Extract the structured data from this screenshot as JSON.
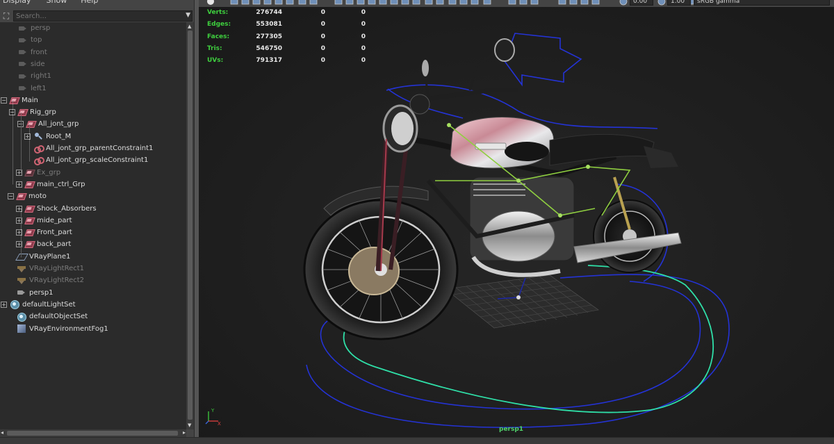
{
  "menu": {
    "display": "Display",
    "show": "Show",
    "help": "Help"
  },
  "search": {
    "placeholder": "Search..."
  },
  "outliner": {
    "items": [
      {
        "label": "persp",
        "icon": "camera-icon",
        "dim": true
      },
      {
        "label": "top",
        "icon": "camera-icon",
        "dim": true
      },
      {
        "label": "front",
        "icon": "camera-icon",
        "dim": true
      },
      {
        "label": "side",
        "icon": "camera-icon",
        "dim": true
      },
      {
        "label": "right1",
        "icon": "camera-icon",
        "dim": true
      },
      {
        "label": "left1",
        "icon": "camera-icon",
        "dim": true
      },
      {
        "label": "Main",
        "icon": "group-icon",
        "expanded": true
      },
      {
        "label": "Rig_grp",
        "icon": "group-icon",
        "expanded": true
      },
      {
        "label": "All_jont_grp",
        "icon": "group-icon",
        "expanded": true
      },
      {
        "label": "Root_M",
        "icon": "joint-icon",
        "expanded": false
      },
      {
        "label": "All_jont_grp_parentConstraint1",
        "icon": "constraint-icon"
      },
      {
        "label": "All_jont_grp_scaleConstraint1",
        "icon": "constraint-icon"
      },
      {
        "label": "Ex_grp",
        "icon": "group-icon",
        "dim": true,
        "expanded": false
      },
      {
        "label": "main_ctrl_Grp",
        "icon": "group-icon",
        "expanded": false
      },
      {
        "label": "moto",
        "icon": "group-icon",
        "expanded": true
      },
      {
        "label": "Shock_Absorbers",
        "icon": "group-icon",
        "expanded": false
      },
      {
        "label": "mide_part",
        "icon": "group-icon",
        "expanded": false
      },
      {
        "label": "Front_part",
        "icon": "group-icon",
        "expanded": false
      },
      {
        "label": "back_part",
        "icon": "group-icon",
        "expanded": false
      },
      {
        "label": "VRayPlane1",
        "icon": "plane-icon"
      },
      {
        "label": "VRayLightRect1",
        "icon": "rect-light-icon",
        "dim": true
      },
      {
        "label": "VRayLightRect2",
        "icon": "rect-light-icon",
        "dim": true
      },
      {
        "label": "persp1",
        "icon": "camera-icon"
      },
      {
        "label": "defaultLightSet",
        "icon": "set-icon",
        "expanded": false
      },
      {
        "label": "defaultObjectSet",
        "icon": "set-icon"
      },
      {
        "label": "VRayEnvironmentFog1",
        "icon": "fog-icon"
      }
    ]
  },
  "toolbar": {
    "value_a": "0.00",
    "value_b": "1.00",
    "color_space": "sRGB gamma"
  },
  "hud": {
    "rows": [
      {
        "label": "Verts:",
        "v1": "276744",
        "v2": "0",
        "v3": "0"
      },
      {
        "label": "Edges:",
        "v1": "553081",
        "v2": "0",
        "v3": "0"
      },
      {
        "label": "Faces:",
        "v1": "277305",
        "v2": "0",
        "v3": "0"
      },
      {
        "label": "Tris:",
        "v1": "546750",
        "v2": "0",
        "v3": "0"
      },
      {
        "label": "UVs:",
        "v1": "791317",
        "v2": "0",
        "v3": "0"
      }
    ],
    "camera": "persp1",
    "axis_y": "Y",
    "axis_x": "X"
  },
  "colors": {
    "hud_label": "#3ecf3e",
    "camera_label": "#4fd26a",
    "curve_blue": "#2433d6",
    "curve_cyan": "#2fe0a8"
  }
}
